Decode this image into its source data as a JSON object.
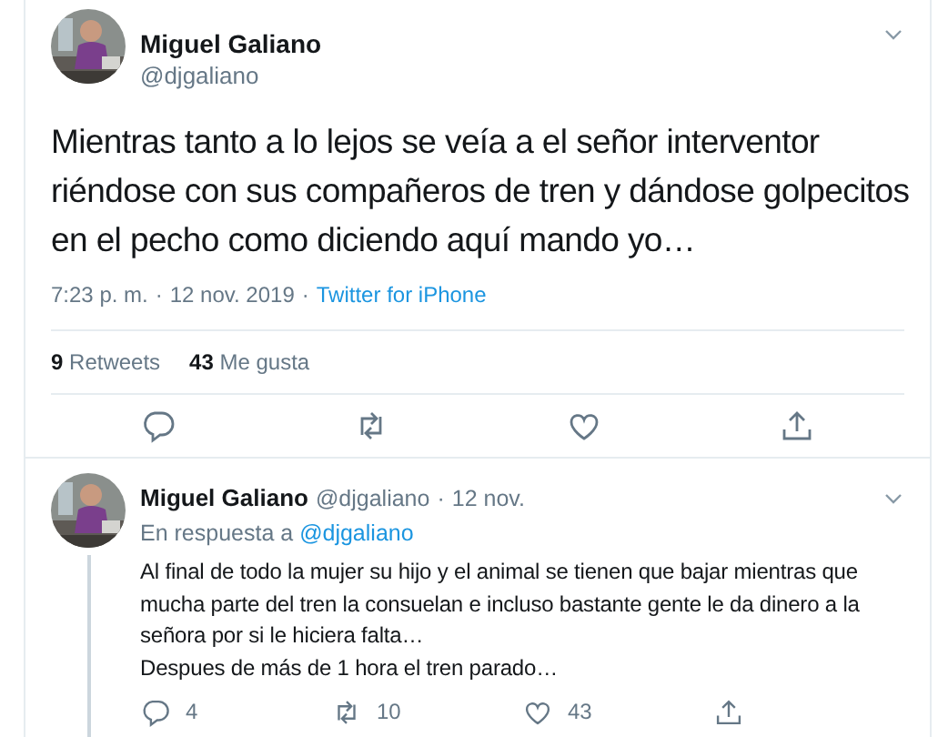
{
  "tweet": {
    "author": {
      "name": "Miguel Galiano",
      "handle": "@djgaliano"
    },
    "text": "Mientras tanto a lo lejos se veía a el señor interventor riéndose con sus compañeros de tren y dándose golpecitos en el pecho como diciendo aquí mando yo…",
    "time": "7:23 p. m.",
    "separator": "·",
    "date": "12 nov. 2019",
    "source": "Twitter for iPhone",
    "stats": [
      {
        "count": "9",
        "label": "Retweets"
      },
      {
        "count": "43",
        "label": "Me gusta"
      }
    ],
    "actions": [
      {
        "kind": "reply"
      },
      {
        "kind": "retweet"
      },
      {
        "kind": "like"
      },
      {
        "kind": "share"
      }
    ]
  },
  "reply": {
    "author": {
      "name": "Miguel Galiano",
      "handle": "@djgaliano"
    },
    "separator": "·",
    "date": "12 nov.",
    "in_reply_to": {
      "label": "En respuesta a",
      "handle": "@djgaliano"
    },
    "paragraphs": [
      "Al final de todo la mujer su hijo y el animal se tienen que bajar mientras que mucha parte del tren la consuelan e incluso bastante gente le da dinero a la señora por si le hiciera falta…",
      "Despues de más de 1 hora el tren parado…"
    ],
    "actions": [
      {
        "kind": "reply",
        "count": "4"
      },
      {
        "kind": "retweet",
        "count": "10"
      },
      {
        "kind": "like",
        "count": "43"
      },
      {
        "kind": "share"
      }
    ]
  }
}
